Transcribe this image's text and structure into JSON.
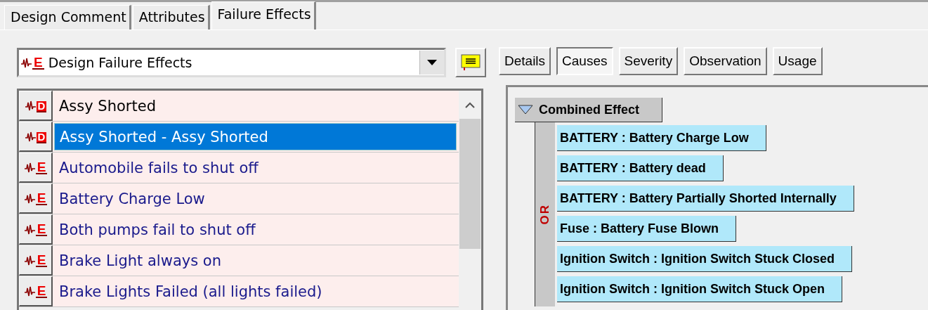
{
  "tabs": [
    {
      "label": "Design Comment",
      "selected": false
    },
    {
      "label": "Attributes",
      "selected": false
    },
    {
      "label": "Failure Effects",
      "selected": true
    }
  ],
  "effect_type": {
    "badge": "E",
    "value": "Design Failure Effects"
  },
  "view_buttons": [
    {
      "label": "Details",
      "selected": false
    },
    {
      "label": "Causes",
      "selected": true
    },
    {
      "label": "Severity",
      "selected": false
    },
    {
      "label": "Observation",
      "selected": false
    },
    {
      "label": "Usage",
      "selected": false
    }
  ],
  "effects": [
    {
      "kind": "design",
      "badge": "D",
      "label": "Assy Shorted",
      "selected": false
    },
    {
      "kind": "design",
      "badge": "D",
      "label": "Assy Shorted - Assy Shorted",
      "selected": true
    },
    {
      "kind": "effect",
      "badge": "E",
      "label": "Automobile fails to shut off",
      "selected": false
    },
    {
      "kind": "effect",
      "badge": "E",
      "label": "Battery Charge Low",
      "selected": false
    },
    {
      "kind": "effect",
      "badge": "E",
      "label": "Both pumps fail to shut off",
      "selected": false
    },
    {
      "kind": "effect",
      "badge": "E",
      "label": "Brake Light always on",
      "selected": false
    },
    {
      "kind": "effect",
      "badge": "E",
      "label": "Brake Lights Failed (all lights failed)",
      "selected": false
    }
  ],
  "cause_tree": {
    "label": "Combined Effect",
    "expanded": true,
    "gate": "OR",
    "children": [
      {
        "label": "BATTERY : Battery Charge Low"
      },
      {
        "label": "BATTERY : Battery dead"
      },
      {
        "label": "BATTERY : Battery Partially Shorted Internally"
      },
      {
        "label": "Fuse : Battery Fuse Blown"
      },
      {
        "label": "Ignition Switch : Ignition Switch Stuck Closed"
      },
      {
        "label": "Ignition Switch : Ignition Switch Stuck Open"
      }
    ]
  }
}
